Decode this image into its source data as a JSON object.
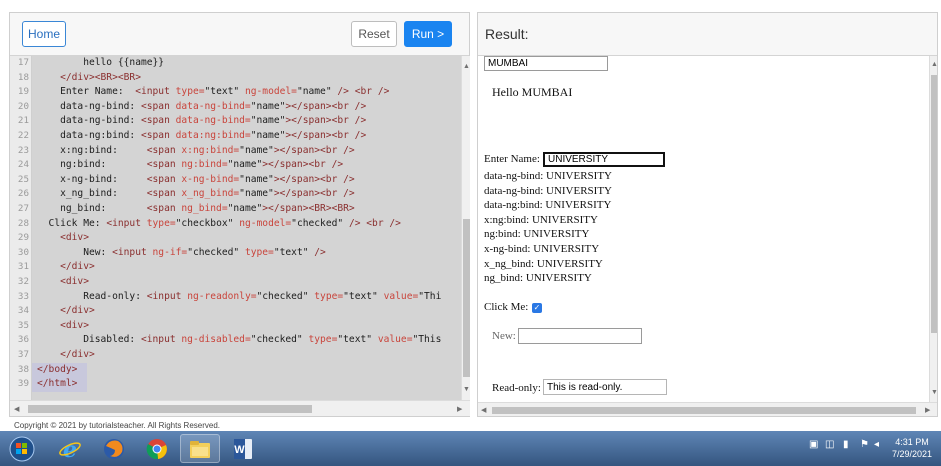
{
  "toolbar": {
    "home_label": "Home",
    "reset_label": "Reset",
    "run_label": "Run >"
  },
  "editor": {
    "lines": [
      {
        "n": "17",
        "segs": [
          [
            "t-text",
            "        hello {{name}}"
          ]
        ]
      },
      {
        "n": "18",
        "segs": [
          [
            "t-tag",
            "    </div><BR><BR>"
          ]
        ]
      },
      {
        "n": "19",
        "segs": [
          [
            "t-text",
            "    Enter Name:  "
          ],
          [
            "t-tag",
            "<input "
          ],
          [
            "t-attr",
            "type="
          ],
          [
            "t-str",
            "\"text\" "
          ],
          [
            "t-attr",
            "ng-model="
          ],
          [
            "t-str",
            "\"name\" "
          ],
          [
            "t-tag",
            "/> <br />"
          ]
        ]
      },
      {
        "n": "20",
        "segs": [
          [
            "t-text",
            "    data-ng-bind: "
          ],
          [
            "t-tag",
            "<span "
          ],
          [
            "t-attr",
            "data-ng-bind="
          ],
          [
            "t-str",
            "\"name\""
          ],
          [
            "t-tag",
            "></span><br />"
          ]
        ]
      },
      {
        "n": "21",
        "segs": [
          [
            "t-text",
            "    data-ng-bind: "
          ],
          [
            "t-tag",
            "<span "
          ],
          [
            "t-attr",
            "data-ng-bind="
          ],
          [
            "t-str",
            "\"name\""
          ],
          [
            "t-tag",
            "></span><br />"
          ]
        ]
      },
      {
        "n": "22",
        "segs": [
          [
            "t-text",
            "    data-ng:bind: "
          ],
          [
            "t-tag",
            "<span "
          ],
          [
            "t-attr",
            "data:ng:bind="
          ],
          [
            "t-str",
            "\"name\""
          ],
          [
            "t-tag",
            "></span><br />"
          ]
        ]
      },
      {
        "n": "23",
        "segs": [
          [
            "t-text",
            "    x:ng:bind:     "
          ],
          [
            "t-tag",
            "<span "
          ],
          [
            "t-attr",
            "x:ng:bind="
          ],
          [
            "t-str",
            "\"name\""
          ],
          [
            "t-tag",
            "></span><br />"
          ]
        ]
      },
      {
        "n": "24",
        "segs": [
          [
            "t-text",
            "    ng:bind:       "
          ],
          [
            "t-tag",
            "<span "
          ],
          [
            "t-attr",
            "ng:bind="
          ],
          [
            "t-str",
            "\"name\""
          ],
          [
            "t-tag",
            "></span><br />"
          ]
        ]
      },
      {
        "n": "25",
        "segs": [
          [
            "t-text",
            "    x-ng-bind:     "
          ],
          [
            "t-tag",
            "<span "
          ],
          [
            "t-attr",
            "x-ng-bind="
          ],
          [
            "t-str",
            "\"name\""
          ],
          [
            "t-tag",
            "></span><br />"
          ]
        ]
      },
      {
        "n": "26",
        "segs": [
          [
            "t-text",
            "    x_ng_bind:     "
          ],
          [
            "t-tag",
            "<span "
          ],
          [
            "t-attr",
            "x_ng_bind="
          ],
          [
            "t-str",
            "\"name\""
          ],
          [
            "t-tag",
            "></span><br />"
          ]
        ]
      },
      {
        "n": "27",
        "segs": [
          [
            "t-text",
            "    ng_bind:       "
          ],
          [
            "t-tag",
            "<span "
          ],
          [
            "t-attr",
            "ng_bind="
          ],
          [
            "t-str",
            "\"name\""
          ],
          [
            "t-tag",
            "></span><BR><BR>"
          ]
        ]
      },
      {
        "n": "28",
        "segs": [
          [
            "t-text",
            "  Click Me: "
          ],
          [
            "t-tag",
            "<input "
          ],
          [
            "t-attr",
            "type="
          ],
          [
            "t-str",
            "\"checkbox\" "
          ],
          [
            "t-attr",
            "ng-model="
          ],
          [
            "t-str",
            "\"checked\" "
          ],
          [
            "t-tag",
            "/> <br />"
          ]
        ]
      },
      {
        "n": "29",
        "segs": [
          [
            "t-tag",
            "    <div>"
          ]
        ]
      },
      {
        "n": "30",
        "segs": [
          [
            "t-text",
            "        New: "
          ],
          [
            "t-tag",
            "<input "
          ],
          [
            "t-attr",
            "ng-if="
          ],
          [
            "t-str",
            "\"checked\" "
          ],
          [
            "t-attr",
            "type="
          ],
          [
            "t-str",
            "\"text\" "
          ],
          [
            "t-tag",
            "/>"
          ]
        ]
      },
      {
        "n": "31",
        "segs": [
          [
            "t-tag",
            "    </div>"
          ]
        ]
      },
      {
        "n": "32",
        "segs": [
          [
            "t-tag",
            "    <div>"
          ]
        ]
      },
      {
        "n": "33",
        "segs": [
          [
            "t-text",
            "        Read-only: "
          ],
          [
            "t-tag",
            "<input "
          ],
          [
            "t-attr",
            "ng-readonly="
          ],
          [
            "t-str",
            "\"checked\" "
          ],
          [
            "t-attr",
            "type="
          ],
          [
            "t-str",
            "\"text\" "
          ],
          [
            "t-attr",
            "value="
          ],
          [
            "t-str",
            "\"Thi"
          ]
        ]
      },
      {
        "n": "34",
        "segs": [
          [
            "t-tag",
            "    </div>"
          ]
        ]
      },
      {
        "n": "35",
        "segs": [
          [
            "t-tag",
            "    <div>"
          ]
        ]
      },
      {
        "n": "36",
        "segs": [
          [
            "t-text",
            "        Disabled: "
          ],
          [
            "t-tag",
            "<input "
          ],
          [
            "t-attr",
            "ng-disabled="
          ],
          [
            "t-str",
            "\"checked\" "
          ],
          [
            "t-attr",
            "type="
          ],
          [
            "t-str",
            "\"text\" "
          ],
          [
            "t-attr",
            "value="
          ],
          [
            "t-str",
            "\"This"
          ]
        ]
      },
      {
        "n": "37",
        "segs": [
          [
            "t-tag",
            "    </div>"
          ]
        ]
      },
      {
        "n": "38",
        "segs": [
          [
            "t-tag",
            "</body>"
          ]
        ],
        "highlight": true
      },
      {
        "n": "39",
        "segs": [
          [
            "t-tag",
            "</html>"
          ]
        ],
        "highlight": true
      }
    ]
  },
  "result": {
    "title": "Result:",
    "top_input_value": "MUMBAI",
    "hello_text": "Hello MUMBAI",
    "enter_name_label": "Enter Name:",
    "enter_name_value": "UNIVERSITY",
    "bindings": [
      "data-ng-bind: UNIVERSITY",
      "data-ng-bind: UNIVERSITY",
      "data-ng:bind: UNIVERSITY",
      "x:ng:bind: UNIVERSITY",
      "ng:bind: UNIVERSITY",
      "x-ng-bind: UNIVERSITY",
      "x_ng_bind: UNIVERSITY",
      "ng_bind: UNIVERSITY"
    ],
    "click_me_label": "Click Me:",
    "checkbox_checked": true,
    "new_label": "New:",
    "new_value": "",
    "readonly_label": "Read-only:",
    "readonly_value": "This is read-only."
  },
  "footer": {
    "copyright": "Copyright © 2021 by tutorialsteacher. All Rights Reserved."
  },
  "taskbar": {
    "apps": [
      "start-orb-icon",
      "internet-explorer-icon",
      "firefox-icon",
      "chrome-icon",
      "file-explorer-icon",
      "word-icon"
    ],
    "time": "4:31 PM",
    "date": "7/29/2021"
  },
  "colors": {
    "run_button": "#1a84f0",
    "home_border": "#3a87d6",
    "editor_bg": "#d4d4d4",
    "tag": "#8a2f2f",
    "attr": "#c9453c",
    "checkbox": "#2a78e4"
  }
}
